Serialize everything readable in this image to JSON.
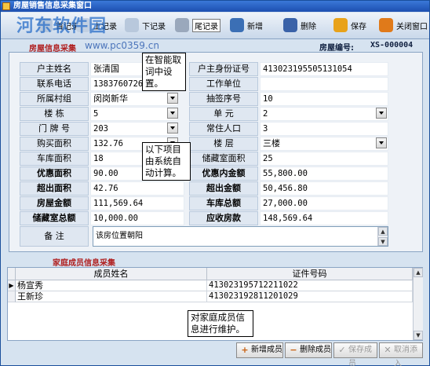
{
  "window": {
    "title": "房屋销售信息采集窗口"
  },
  "watermark": {
    "text": "河东软件园",
    "url": "www.pc0359.cn"
  },
  "toolbar": {
    "items": [
      {
        "label": "首记录"
      },
      {
        "label": "上记录"
      },
      {
        "label": "下记录"
      },
      {
        "label": "尾记录"
      },
      {
        "label": "新增"
      },
      {
        "label": "删除"
      },
      {
        "label": "保存"
      },
      {
        "label": "关闭窗口"
      }
    ]
  },
  "house_section": {
    "title": "房屋信息采集",
    "house_no_label": "房屋编号:",
    "house_no_value": "XS-000004"
  },
  "form": {
    "owner_name_label": "户主姓名",
    "owner_name": "张清国",
    "owner_id_label": "户主身份证号",
    "owner_id": "413023195505131054",
    "phone_label": "联系电话",
    "phone": "13837607262",
    "work_unit_label": "工作单位",
    "work_unit": "",
    "village_label": "所属村组",
    "village": "闵岗新华",
    "lottery_no_label": "抽签序号",
    "lottery_no": "10",
    "building_label": "楼    栋",
    "building": "5",
    "unit_label": "单    元",
    "unit": "2",
    "door_no_label": "门 牌 号",
    "door_no": "203",
    "residents_label": "常住人口",
    "residents": "3",
    "area_label": "购买面积",
    "area": "132.76",
    "floor_label": "楼    层",
    "floor": "三楼",
    "garage_area_label": "车库面积",
    "garage_area": "18",
    "storage_area_label": "储藏室面积",
    "storage_area": "25",
    "discount_area_label": "优惠面积",
    "discount_area": "90.00",
    "discount_amount_label": "优惠内金额",
    "discount_amount": "55,800.00",
    "excess_area_label": "超出面积",
    "excess_area": "42.76",
    "excess_amount_label": "超出金额",
    "excess_amount": "50,456.80",
    "house_total_label": "房屋金额",
    "house_total": "111,569.64",
    "garage_total_label": "车库总额",
    "garage_total": "27,000.00",
    "storage_total_label": "储藏室总额",
    "storage_total": "10,000.00",
    "receivable_label": "应收房款",
    "receivable": "148,569.64",
    "remark_label": "备    注",
    "remark": "该房位置朝阳"
  },
  "tips": {
    "tip1": "在智能取词中设置。",
    "tip2": "以下项目由系统自动计算。",
    "tip3": "对家庭成员信息进行维护。"
  },
  "family_section": {
    "title": "家庭成员信息采集",
    "columns": [
      "成员姓名",
      "证件号码"
    ],
    "rows": [
      {
        "name": "杨宣秀",
        "id": "413023195712211022"
      },
      {
        "name": "王新珍",
        "id": "413023192811201029"
      }
    ]
  },
  "buttons": {
    "add_member": "新增成员",
    "delete_member": "删除成员",
    "save_member": "保存成员",
    "cancel_add": "取消添入"
  }
}
